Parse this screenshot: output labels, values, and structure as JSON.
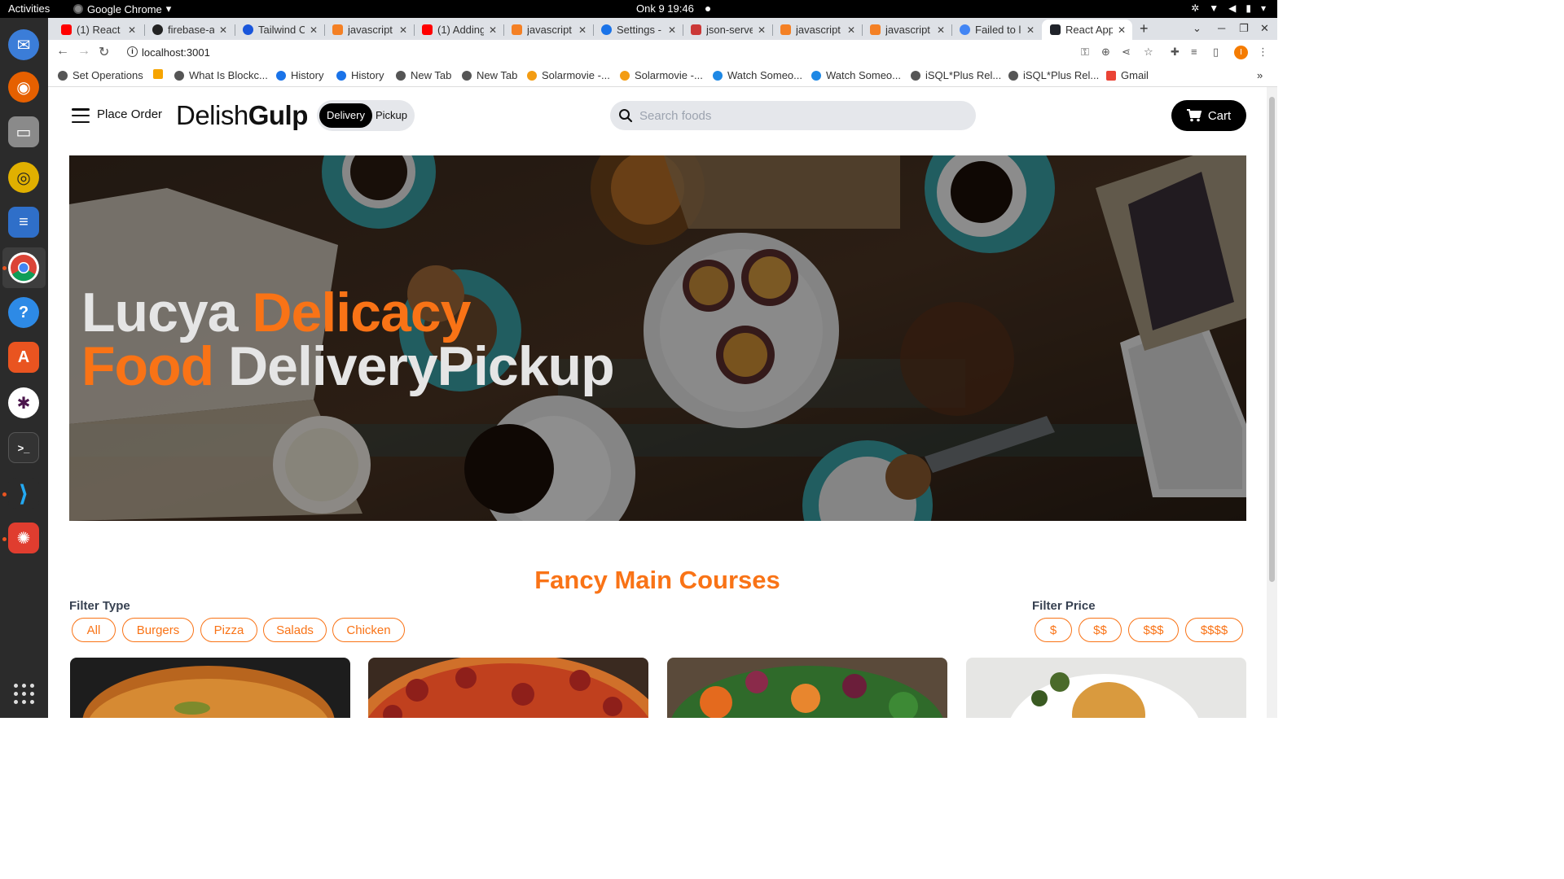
{
  "os": {
    "activities": "Activities",
    "app_name": "Google Chrome",
    "clock": "Onk 9  19:46"
  },
  "browser": {
    "tabs": [
      {
        "title": "(1) React F",
        "favicon": "youtube-icon",
        "color": "#ff0000"
      },
      {
        "title": "firebase-a",
        "favicon": "github-icon",
        "color": "#222222"
      },
      {
        "title": "Tailwind C",
        "favicon": "tailwind-icon",
        "color": "#1a56db"
      },
      {
        "title": "javascript",
        "favicon": "stackoverflow-icon",
        "color": "#f48024"
      },
      {
        "title": "(1) Adding",
        "favicon": "youtube-icon",
        "color": "#ff0000"
      },
      {
        "title": "javascript",
        "favicon": "stackoverflow-icon",
        "color": "#f48024"
      },
      {
        "title": "Settings -",
        "favicon": "gear-icon",
        "color": "#1a73e8"
      },
      {
        "title": "json-serve",
        "favicon": "npm-icon",
        "color": "#cb3837"
      },
      {
        "title": "javascript",
        "favicon": "stackoverflow-icon",
        "color": "#f48024"
      },
      {
        "title": "javascript",
        "favicon": "stackoverflow-icon",
        "color": "#f48024"
      },
      {
        "title": "Failed to lo",
        "favicon": "google-icon",
        "color": "#4285f4"
      },
      {
        "title": "React App",
        "favicon": "react-icon",
        "color": "#20232a"
      }
    ],
    "url": "localhost:3001",
    "bookmarks": [
      {
        "label": "Set Operations",
        "color": "#555555"
      },
      {
        "label": "",
        "color": "#f6a400"
      },
      {
        "label": "What Is Blockc...",
        "color": "#555555"
      },
      {
        "label": "History",
        "color": "#1a73e8"
      },
      {
        "label": "History",
        "color": "#1a73e8"
      },
      {
        "label": "New Tab",
        "color": "#555555"
      },
      {
        "label": "New Tab",
        "color": "#555555"
      },
      {
        "label": "Solarmovie -...",
        "color": "#f39c12"
      },
      {
        "label": "Solarmovie -...",
        "color": "#f39c12"
      },
      {
        "label": "Watch Someo...",
        "color": "#1e88e5"
      },
      {
        "label": "Watch Someo...",
        "color": "#1e88e5"
      },
      {
        "label": "iSQL*Plus Rel...",
        "color": "#555555"
      },
      {
        "label": "iSQL*Plus Rel...",
        "color": "#555555"
      },
      {
        "label": "Gmail",
        "color": "#ea4335"
      }
    ]
  },
  "app": {
    "menu_label": "Place Order",
    "logo_light": "Delish",
    "logo_bold": "Gulp",
    "toggle": {
      "delivery": "Delivery",
      "pickup": "Pickup"
    },
    "search_placeholder": "Search foods",
    "cart_label": "Cart",
    "hero": {
      "word1": "Lucya ",
      "word2": "Delicacy",
      "word3": "Food ",
      "word4": "DeliveryPickup"
    },
    "section_title": "Fancy Main Courses",
    "filter_type": {
      "label": "Filter Type",
      "options": [
        "All",
        "Burgers",
        "Pizza",
        "Salads",
        "Chicken"
      ]
    },
    "filter_price": {
      "label": "Filter Price",
      "options": [
        "$",
        "$$",
        "$$$",
        "$$$$"
      ]
    },
    "colors": {
      "accent": "#f97316",
      "dark": "#000000"
    }
  }
}
